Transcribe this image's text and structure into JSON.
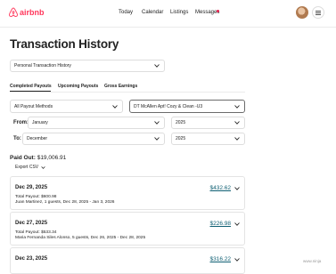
{
  "header": {
    "brand": "airbnb",
    "nav": [
      "Today",
      "Calendar",
      "Listings",
      "Messages"
    ],
    "messages_badge": true,
    "accent": "#ff385c"
  },
  "page": {
    "title": "Transaction History"
  },
  "filters": {
    "history_type": "Personal Transaction History",
    "payout_method": "All Payout Methods",
    "listing": "DT McAllen Apt! Cozy & Clean -U3",
    "from_label": "From:",
    "from_month": "January",
    "from_year": "2025",
    "to_label": "To:",
    "to_month": "December",
    "to_year": "2025"
  },
  "tabs": [
    {
      "label": "Completed Payouts",
      "active": true
    },
    {
      "label": "Upcoming Payouts",
      "active": false
    },
    {
      "label": "Gross Earnings",
      "active": false
    }
  ],
  "summary": {
    "paid_out_label": "Paid Out:",
    "paid_out_value": "$19,006.91",
    "export_label": "Export CSV"
  },
  "payouts": [
    {
      "date": "Dec 29, 2025",
      "amount": "$432.62",
      "total": "Total Payout: $600.98",
      "details": "Juan Martinez, 1 guests, Dec 28, 2025 - Jan 3, 2026"
    },
    {
      "date": "Dec 27, 2025",
      "amount": "$226.98",
      "total": "Total Payout: $533.34",
      "details": "Maria Fernanda Siles Alonso, 5 guests, Dec 26, 2025 - Dec 28, 2025"
    },
    {
      "date": "Dec 23, 2025",
      "amount": "$316.22"
    }
  ],
  "watermark": "www.ninja"
}
